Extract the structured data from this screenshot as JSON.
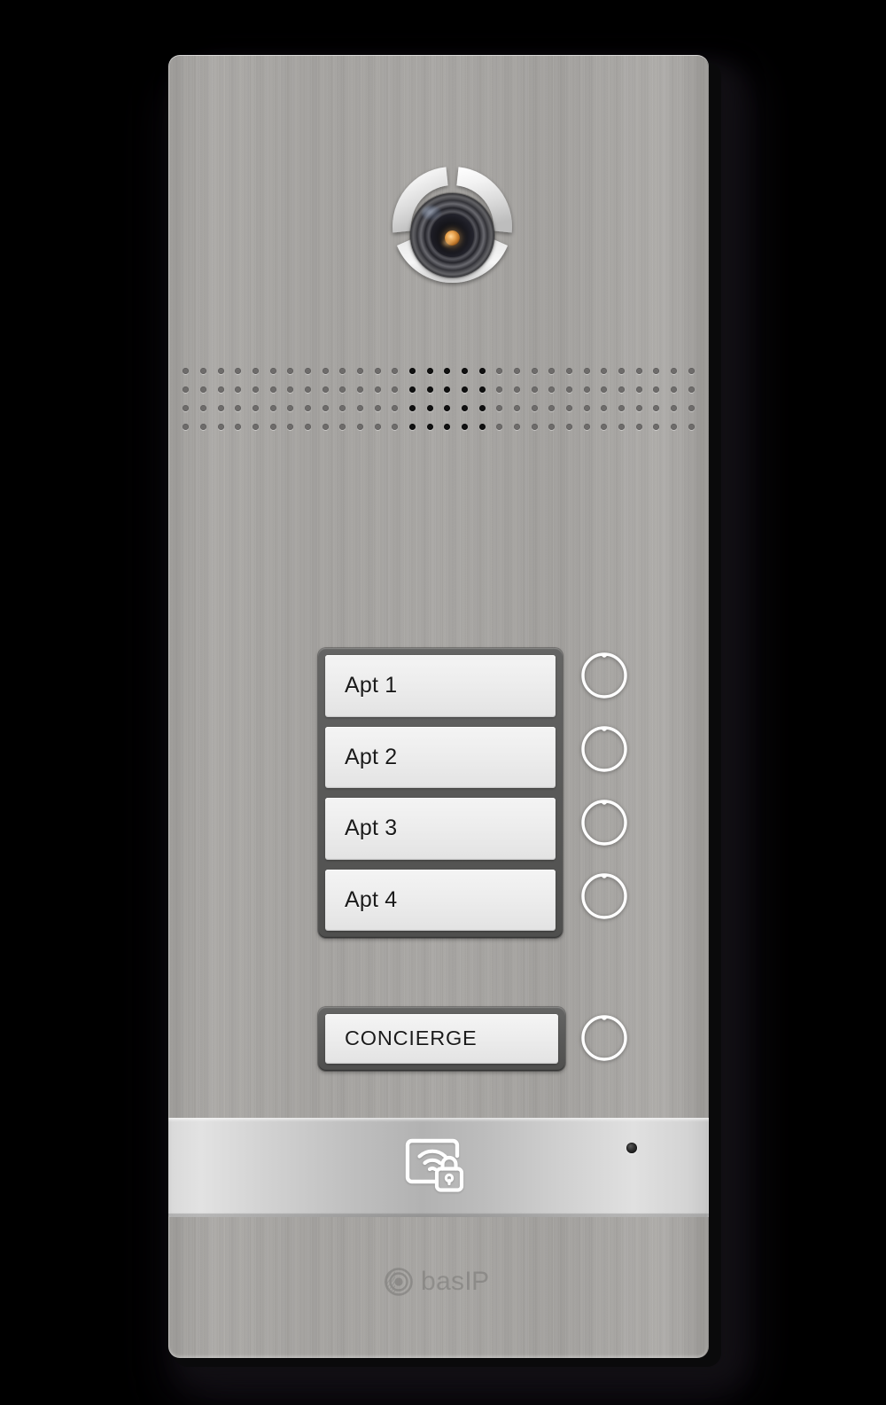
{
  "device": {
    "name": "bas-ip-multi-apartment-door-entry-panel",
    "brand_text_bas": "bas",
    "brand_text_ip": "IP",
    "panel_color": "#a6a4a1",
    "frame_color": "#595958",
    "plate_color": "#ededed",
    "label_color": "#1b1b1b",
    "button_ring_color": "#ffffff",
    "rfid_strip_color": "#c9c9c9",
    "led_color": "#1d1d1d"
  },
  "camera": {
    "icon": "camera-lens-icon",
    "ring_segments": 3
  },
  "speaker": {
    "icon": "speaker-grille-icon",
    "rows": 4,
    "columns": 30,
    "mic_columns": [
      13,
      14,
      15,
      16,
      17
    ]
  },
  "call_directory": {
    "entries": [
      {
        "label": "Apt 1",
        "button_icon": "call-button-ring-icon"
      },
      {
        "label": "Apt 2",
        "button_icon": "call-button-ring-icon"
      },
      {
        "label": "Apt 3",
        "button_icon": "call-button-ring-icon"
      },
      {
        "label": "Apt 4",
        "button_icon": "call-button-ring-icon"
      }
    ]
  },
  "concierge": {
    "label": "CONCIERGE",
    "button_icon": "call-button-ring-icon"
  },
  "reader": {
    "icon": "rfid-card-lock-icon",
    "led_icon": "status-led-indicator"
  }
}
